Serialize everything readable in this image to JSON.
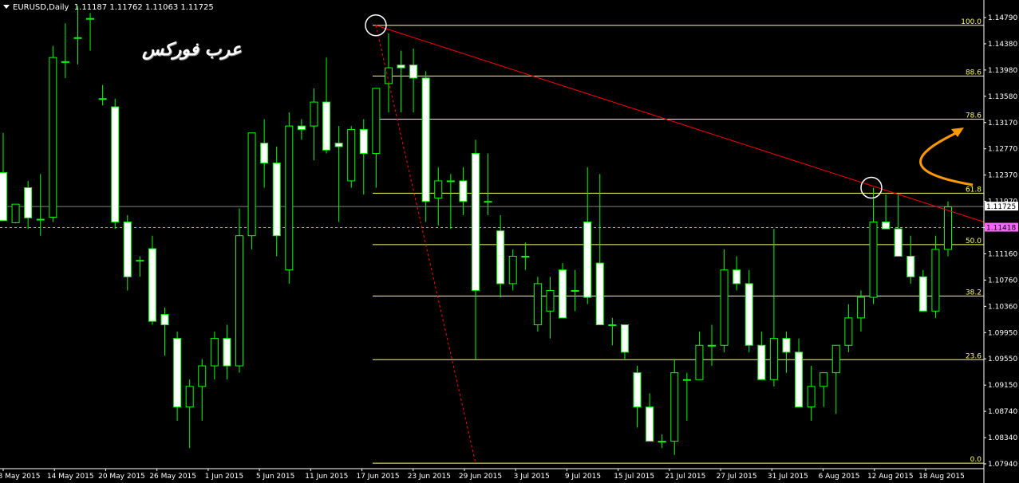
{
  "window": {
    "symbol_timeframe": "EURUSD,Daily",
    "ohlc": "1.11187 1.11762 1.11063 1.11725"
  },
  "watermark": "عرب فوركس",
  "colors": {
    "background": "#000000",
    "candle_up": "#000000",
    "candle_down": "#ffffff",
    "wick": "#00ff00",
    "fib_line": "#ffff66",
    "trendline": "#ff0000",
    "arrow": "#ff9900",
    "axis": "#ffffff",
    "current_price_line": "#808080",
    "bid_line": "#ff66ff"
  },
  "chart_data": {
    "type": "candlestick",
    "ylim": [
      1.079,
      1.146
    ],
    "price_axis_labels": [
      "1.14790",
      "1.14380",
      "1.13980",
      "1.13580",
      "1.13170",
      "1.12770",
      "1.12370",
      "1.11970",
      "1.11560",
      "1.11160",
      "1.10760",
      "1.10360",
      "1.09950",
      "1.09550",
      "1.09150",
      "1.08740",
      "1.08340",
      "1.07940"
    ],
    "date_labels": [
      "8 May 2015",
      "14 May 2015",
      "20 May 2015",
      "26 May 2015",
      "1 Jun 2015",
      "5 Jun 2015",
      "11 Jun 2015",
      "17 Jun 2015",
      "23 Jun 2015",
      "29 Jun 2015",
      "3 Jul 2015",
      "9 Jul 2015",
      "15 Jul 2015",
      "21 Jul 2015",
      "27 Jul 2015",
      "31 Jul 2015",
      "6 Aug 2015",
      "12 Aug 2015",
      "18 Aug 2015"
    ],
    "current_price": "1.11725",
    "bid_price": "1.11418",
    "fibonacci": [
      {
        "label": "100.0",
        "price": 1.1437
      },
      {
        "label": "88.6",
        "price": 1.1363
      },
      {
        "label": "78.6",
        "price": 1.13
      },
      {
        "label": "61.8",
        "price": 1.1192
      },
      {
        "label": "50.0",
        "price": 1.1117
      },
      {
        "label": "38.2",
        "price": 1.1042
      },
      {
        "label": "23.6",
        "price": 1.0949
      },
      {
        "label": "0.0",
        "price": 1.0798
      }
    ],
    "candles": [
      [
        1.1222,
        1.128,
        1.1152,
        1.1152
      ],
      [
        1.1149,
        1.1176,
        1.1148,
        1.1176
      ],
      [
        1.12,
        1.121,
        1.114,
        1.1156
      ],
      [
        1.1153,
        1.122,
        1.113,
        1.1154
      ],
      [
        1.1157,
        1.1407,
        1.115,
        1.139
      ],
      [
        1.1384,
        1.144,
        1.136,
        1.1384
      ],
      [
        1.1419,
        1.1465,
        1.138,
        1.1419
      ],
      [
        1.1447,
        1.1455,
        1.14,
        1.1447
      ],
      [
        1.133,
        1.135,
        1.132,
        1.133
      ],
      [
        1.1318,
        1.133,
        1.114,
        1.115
      ],
      [
        1.115,
        1.116,
        1.105,
        1.107
      ],
      [
        1.1094,
        1.11,
        1.107,
        1.1094
      ],
      [
        1.1111,
        1.113,
        1.1,
        1.1005
      ],
      [
        1.1015,
        1.1025,
        1.0955,
        1.1
      ],
      [
        1.098,
        1.099,
        1.086,
        1.088
      ],
      [
        1.088,
        1.092,
        1.082,
        1.091
      ],
      [
        1.091,
        1.095,
        1.086,
        1.094
      ],
      [
        1.094,
        1.099,
        1.092,
        1.098
      ],
      [
        1.098,
        1.1,
        1.092,
        1.094
      ],
      [
        1.094,
        1.117,
        1.093,
        1.113
      ],
      [
        1.113,
        1.128,
        1.111,
        1.128
      ],
      [
        1.1265,
        1.13,
        1.12,
        1.1236
      ],
      [
        1.1236,
        1.126,
        1.11,
        1.113
      ],
      [
        1.108,
        1.131,
        1.106,
        1.129
      ],
      [
        1.129,
        1.13,
        1.127,
        1.1285
      ],
      [
        1.129,
        1.1345,
        1.124,
        1.1325
      ],
      [
        1.1325,
        1.139,
        1.125,
        1.1255
      ],
      [
        1.1265,
        1.129,
        1.115,
        1.126
      ],
      [
        1.121,
        1.129,
        1.12,
        1.1285
      ],
      [
        1.1285,
        1.13,
        1.119,
        1.125
      ],
      [
        1.125,
        1.134,
        1.12,
        1.1345
      ],
      [
        1.1352,
        1.1425,
        1.131,
        1.1375
      ],
      [
        1.1379,
        1.14,
        1.131,
        1.1375
      ],
      [
        1.1379,
        1.1403,
        1.131,
        1.136
      ],
      [
        1.136,
        1.137,
        1.115,
        1.118
      ],
      [
        1.1185,
        1.123,
        1.1145,
        1.121
      ],
      [
        1.121,
        1.122,
        1.114,
        1.121
      ],
      [
        1.121,
        1.123,
        1.116,
        1.118
      ],
      [
        1.125,
        1.127,
        1.095,
        1.105
      ],
      [
        1.118,
        1.125,
        1.116,
        1.118
      ],
      [
        1.1137,
        1.116,
        1.104,
        1.106
      ],
      [
        1.106,
        1.111,
        1.105,
        1.11
      ],
      [
        1.11,
        1.112,
        1.108,
        1.11
      ],
      [
        1.1,
        1.107,
        1.099,
        1.106
      ],
      [
        1.102,
        1.107,
        1.098,
        1.105
      ],
      [
        1.108,
        1.109,
        1.103,
        1.101
      ],
      [
        1.105,
        1.108,
        1.102,
        1.105
      ],
      [
        1.115,
        1.123,
        1.103,
        1.104
      ],
      [
        1.109,
        1.122,
        1.103,
        1.1
      ],
      [
        1.1,
        1.101,
        1.097,
        1.1
      ],
      [
        1.1,
        1.099,
        1.095,
        1.096
      ],
      [
        1.093,
        1.094,
        1.085,
        1.088
      ],
      [
        1.088,
        1.09,
        1.083,
        1.083
      ],
      [
        1.083,
        1.084,
        1.082,
        1.083
      ],
      [
        1.083,
        1.095,
        1.081,
        1.093
      ],
      [
        1.092,
        1.093,
        1.086,
        1.092
      ],
      [
        1.092,
        1.099,
        1.092,
        1.097
      ],
      [
        1.097,
        1.1,
        1.094,
        1.097
      ],
      [
        1.097,
        1.111,
        1.096,
        1.108
      ],
      [
        1.108,
        1.11,
        1.105,
        1.106
      ],
      [
        1.106,
        1.108,
        1.096,
        1.097
      ],
      [
        1.097,
        1.099,
        1.092,
        1.092
      ],
      [
        1.092,
        1.114,
        1.091,
        1.098
      ],
      [
        1.098,
        1.099,
        1.093,
        1.096
      ],
      [
        1.096,
        1.098,
        1.088,
        1.088
      ],
      [
        1.088,
        1.094,
        1.086,
        1.091
      ],
      [
        1.091,
        1.093,
        1.088,
        1.093
      ],
      [
        1.093,
        1.097,
        1.087,
        1.097
      ],
      [
        1.097,
        1.103,
        1.096,
        1.101
      ],
      [
        1.101,
        1.105,
        1.099,
        1.104
      ],
      [
        1.104,
        1.12,
        1.103,
        1.115
      ],
      [
        1.115,
        1.119,
        1.114,
        1.114
      ],
      [
        1.114,
        1.119,
        1.11,
        1.11
      ],
      [
        1.11,
        1.113,
        1.106,
        1.107
      ],
      [
        1.107,
        1.108,
        1.102,
        1.102
      ],
      [
        1.102,
        1.113,
        1.101,
        1.111
      ],
      [
        1.111,
        1.118,
        1.11,
        1.1172
      ]
    ]
  }
}
